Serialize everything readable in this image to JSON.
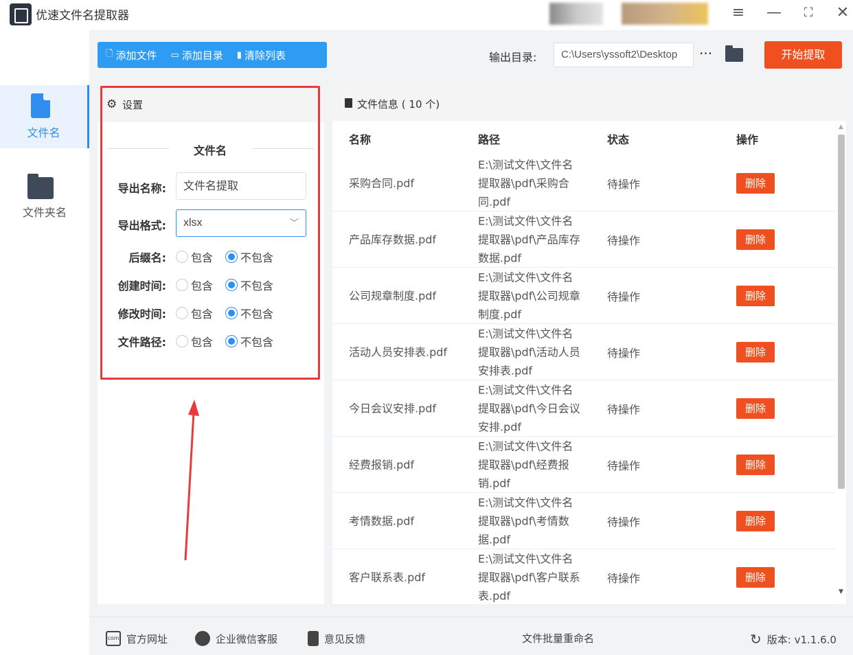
{
  "app": {
    "title": "优速文件名提取器"
  },
  "window": {
    "menu_icon": "≡",
    "min_icon": "—",
    "max_icon": "⛶",
    "close_icon": "✕"
  },
  "sidebar": {
    "items": [
      {
        "label": "文件名",
        "icon": "file-icon",
        "active": true
      },
      {
        "label": "文件夹名",
        "icon": "folder-icon",
        "active": false
      }
    ]
  },
  "toolbar": {
    "add_file": "添加文件",
    "add_dir": "添加目录",
    "clear_list": "清除列表",
    "output_label": "输出目录:",
    "output_value": "C:\\Users\\yssoft2\\Desktop",
    "more": "···",
    "start": "开始提取"
  },
  "settings": {
    "title": "设置",
    "section": "文件名",
    "export_name_label": "导出名称:",
    "export_name_value": "文件名提取",
    "export_format_label": "导出格式:",
    "export_format_value": "xlsx",
    "options": [
      {
        "label": "后缀名:",
        "include": "包含",
        "exclude": "不包含",
        "selected": "exclude"
      },
      {
        "label": "创建时间:",
        "include": "包含",
        "exclude": "不包含",
        "selected": "exclude"
      },
      {
        "label": "修改时间:",
        "include": "包含",
        "exclude": "不包含",
        "selected": "exclude"
      },
      {
        "label": "文件路径:",
        "include": "包含",
        "exclude": "不包含",
        "selected": "exclude"
      }
    ]
  },
  "files": {
    "title": "文件信息",
    "count": "( 10 个)",
    "columns": [
      "名称",
      "路径",
      "状态",
      "操作"
    ],
    "rows": [
      {
        "name": "采购合同.pdf",
        "path": "E:\\测试文件\\文件名提取器\\pdf\\采购合同.pdf",
        "status": "待操作",
        "action": "删除"
      },
      {
        "name": "产品库存数据.pdf",
        "path": "E:\\测试文件\\文件名提取器\\pdf\\产品库存数据.pdf",
        "status": "待操作",
        "action": "删除"
      },
      {
        "name": "公司规章制度.pdf",
        "path": "E:\\测试文件\\文件名提取器\\pdf\\公司规章制度.pdf",
        "status": "待操作",
        "action": "删除"
      },
      {
        "name": "活动人员安排表.pdf",
        "path": "E:\\测试文件\\文件名提取器\\pdf\\活动人员安排表.pdf",
        "status": "待操作",
        "action": "删除"
      },
      {
        "name": "今日会议安排.pdf",
        "path": "E:\\测试文件\\文件名提取器\\pdf\\今日会议安排.pdf",
        "status": "待操作",
        "action": "删除"
      },
      {
        "name": "经费报销.pdf",
        "path": "E:\\测试文件\\文件名提取器\\pdf\\经费报销.pdf",
        "status": "待操作",
        "action": "删除"
      },
      {
        "name": "考情数据.pdf",
        "path": "E:\\测试文件\\文件名提取器\\pdf\\考情数据.pdf",
        "status": "待操作",
        "action": "删除"
      },
      {
        "name": "客户联系表.pdf",
        "path": "E:\\测试文件\\文件名提取器\\pdf\\客户联系表.pdf",
        "status": "待操作",
        "action": "删除"
      }
    ]
  },
  "footer": {
    "website": "官方网址",
    "wechat": "企业微信客服",
    "feedback": "意见反馈",
    "center": "文件批量重命名",
    "version": "版本: v1.1.6.0",
    "website_icon_text": "com"
  },
  "colors": {
    "accent": "#2f9cf3",
    "danger": "#f0501f",
    "highlight": "#e83a3a"
  }
}
